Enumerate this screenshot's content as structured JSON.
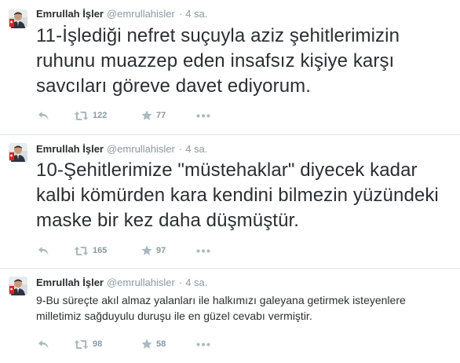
{
  "tweets": [
    {
      "name": "Emrullah İşler",
      "handle": "@emrullahisler",
      "separator": "·",
      "time": "4 sa.",
      "text": "11-İşlediği nefret suçuyla aziz şehitlerimizin ruhunu muazzep eden insafsız kişiye karşı savcıları göreve davet ediyorum.",
      "retweets": "122",
      "favorites": "77"
    },
    {
      "name": "Emrullah İşler",
      "handle": "@emrullahisler",
      "separator": "·",
      "time": "4 sa.",
      "text": "10-Şehitlerimize \"müstehaklar\" diyecek kadar kalbi kömürden kara kendini bilmezin yüzündeki maske bir kez daha düşmüştür.",
      "retweets": "165",
      "favorites": "97"
    },
    {
      "name": "Emrullah İşler",
      "handle": "@emrullahisler",
      "separator": "·",
      "time": "4 sa.",
      "text": "9-Bu süreçte akıl almaz yalanları ile halkımızı galeyana getirmek isteyenlere milletimiz sağduyulu duruşu ile en güzel cevabı vermiştir.",
      "retweets": "98",
      "favorites": "58"
    }
  ],
  "colors": {
    "name": "#292f33",
    "meta": "#8899a6",
    "action_icon": "#aab8c2",
    "divider": "#e1e8ed"
  },
  "icons": {
    "reply": "reply-icon",
    "retweet": "retweet-icon",
    "favorite": "star-icon",
    "more": "more-dots-icon"
  }
}
